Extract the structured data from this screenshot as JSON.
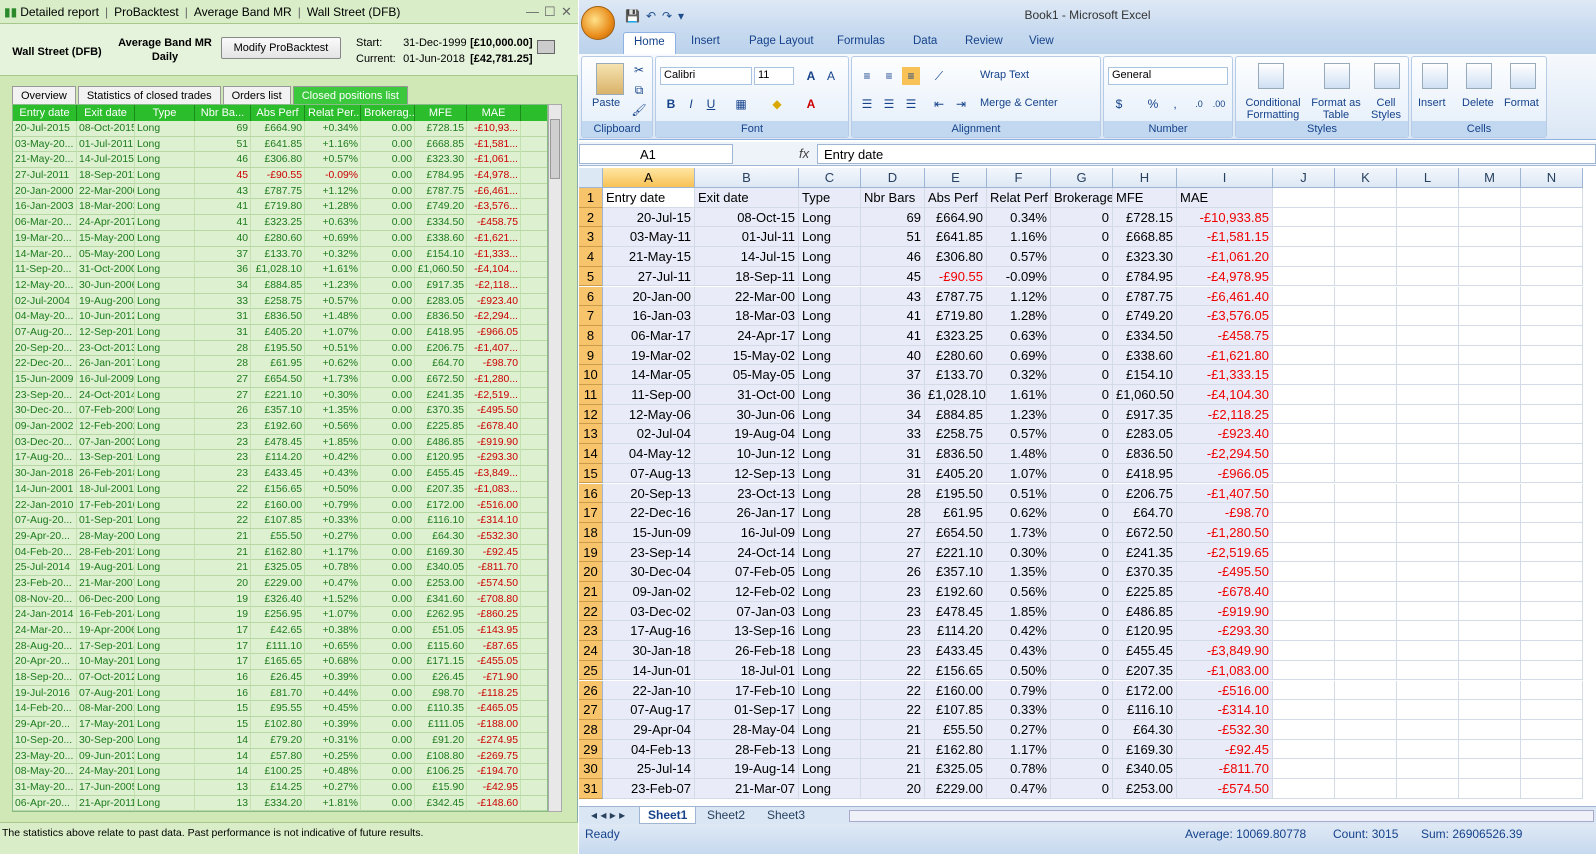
{
  "left": {
    "title": [
      "Detailed report",
      "ProBacktest",
      "Average Band MR",
      "Wall Street (DFB)"
    ],
    "symbol": "Wall Street (DFB)",
    "strategy": "Average Band MR",
    "period": "Daily",
    "modify_button": "Modify ProBacktest",
    "start_label": "Start:",
    "start_date": "31-Dec-1999",
    "start_value": "[£10,000.00]",
    "current_label": "Current:",
    "current_date": "01-Jun-2018",
    "current_value": "[£42,781.25]",
    "tabs": [
      "Overview",
      "Statistics of closed trades",
      "Orders list",
      "Closed positions list"
    ],
    "columns": [
      "Entry date",
      "Exit date",
      "Type",
      "Nbr Ba...",
      "Abs Perf",
      "Relat Per...",
      "Brokerag...",
      "MFE",
      "MAE"
    ],
    "footer": "The statistics above relate to past data. Past performance is not indicative of future results.",
    "rows": [
      [
        "20-Jul-2015",
        "08-Oct-2015",
        "Long",
        "69",
        "£664.90",
        "+0.34%",
        "0.00",
        "£728.15",
        "-£10,93..."
      ],
      [
        "03-May-20...",
        "01-Jul-2011",
        "Long",
        "51",
        "£641.85",
        "+1.16%",
        "0.00",
        "£668.85",
        "-£1,581..."
      ],
      [
        "21-May-20...",
        "14-Jul-2015",
        "Long",
        "46",
        "£306.80",
        "+0.57%",
        "0.00",
        "£323.30",
        "-£1,061..."
      ],
      [
        "27-Jul-2011",
        "18-Sep-2011",
        "Long",
        "45",
        "-£90.55",
        "-0.09%",
        "0.00",
        "£784.95",
        "-£4,978..."
      ],
      [
        "20-Jan-2000",
        "22-Mar-2000",
        "Long",
        "43",
        "£787.75",
        "+1.12%",
        "0.00",
        "£787.75",
        "-£6,461..."
      ],
      [
        "16-Jan-2003",
        "18-Mar-2003",
        "Long",
        "41",
        "£719.80",
        "+1.28%",
        "0.00",
        "£749.20",
        "-£3,576..."
      ],
      [
        "06-Mar-20...",
        "24-Apr-2017",
        "Long",
        "41",
        "£323.25",
        "+0.63%",
        "0.00",
        "£334.50",
        "-£458.75"
      ],
      [
        "19-Mar-20...",
        "15-May-2002",
        "Long",
        "40",
        "£280.60",
        "+0.69%",
        "0.00",
        "£338.60",
        "-£1,621..."
      ],
      [
        "14-Mar-20...",
        "05-May-2005",
        "Long",
        "37",
        "£133.70",
        "+0.32%",
        "0.00",
        "£154.10",
        "-£1,333..."
      ],
      [
        "11-Sep-20...",
        "31-Oct-2000",
        "Long",
        "36",
        "£1,028.10",
        "+1.61%",
        "0.00",
        "£1,060.50",
        "-£4,104..."
      ],
      [
        "12-May-20...",
        "30-Jun-2006",
        "Long",
        "34",
        "£884.85",
        "+1.23%",
        "0.00",
        "£917.35",
        "-£2,118..."
      ],
      [
        "02-Jul-2004",
        "19-Aug-2004",
        "Long",
        "33",
        "£258.75",
        "+0.57%",
        "0.00",
        "£283.05",
        "-£923.40"
      ],
      [
        "04-May-20...",
        "10-Jun-2012",
        "Long",
        "31",
        "£836.50",
        "+1.48%",
        "0.00",
        "£836.50",
        "-£2,294..."
      ],
      [
        "07-Aug-20...",
        "12-Sep-2013",
        "Long",
        "31",
        "£405.20",
        "+1.07%",
        "0.00",
        "£418.95",
        "-£966.05"
      ],
      [
        "20-Sep-20...",
        "23-Oct-2013",
        "Long",
        "28",
        "£195.50",
        "+0.51%",
        "0.00",
        "£206.75",
        "-£1,407..."
      ],
      [
        "22-Dec-20...",
        "26-Jan-2017",
        "Long",
        "28",
        "£61.95",
        "+0.62%",
        "0.00",
        "£64.70",
        "-£98.70"
      ],
      [
        "15-Jun-2009",
        "16-Jul-2009",
        "Long",
        "27",
        "£654.50",
        "+1.73%",
        "0.00",
        "£672.50",
        "-£1,280..."
      ],
      [
        "23-Sep-20...",
        "24-Oct-2014",
        "Long",
        "27",
        "£221.10",
        "+0.30%",
        "0.00",
        "£241.35",
        "-£2,519..."
      ],
      [
        "30-Dec-20...",
        "07-Feb-2005",
        "Long",
        "26",
        "£357.10",
        "+1.35%",
        "0.00",
        "£370.35",
        "-£495.50"
      ],
      [
        "09-Jan-2002",
        "12-Feb-2002",
        "Long",
        "23",
        "£192.60",
        "+0.56%",
        "0.00",
        "£225.85",
        "-£678.40"
      ],
      [
        "03-Dec-20...",
        "07-Jan-2003",
        "Long",
        "23",
        "£478.45",
        "+1.85%",
        "0.00",
        "£486.85",
        "-£919.90"
      ],
      [
        "17-Aug-20...",
        "13-Sep-2016",
        "Long",
        "23",
        "£114.20",
        "+0.42%",
        "0.00",
        "£120.95",
        "-£293.30"
      ],
      [
        "30-Jan-2018",
        "26-Feb-2018",
        "Long",
        "23",
        "£433.45",
        "+0.43%",
        "0.00",
        "£455.45",
        "-£3,849..."
      ],
      [
        "14-Jun-2001",
        "18-Jul-2001",
        "Long",
        "22",
        "£156.65",
        "+0.50%",
        "0.00",
        "£207.35",
        "-£1,083..."
      ],
      [
        "22-Jan-2010",
        "17-Feb-2010",
        "Long",
        "22",
        "£160.00",
        "+0.79%",
        "0.00",
        "£172.00",
        "-£516.00"
      ],
      [
        "07-Aug-20...",
        "01-Sep-2017",
        "Long",
        "22",
        "£107.85",
        "+0.33%",
        "0.00",
        "£116.10",
        "-£314.10"
      ],
      [
        "29-Apr-20...",
        "28-May-2004",
        "Long",
        "21",
        "£55.50",
        "+0.27%",
        "0.00",
        "£64.30",
        "-£532.30"
      ],
      [
        "04-Feb-20...",
        "28-Feb-2013",
        "Long",
        "21",
        "£162.80",
        "+1.17%",
        "0.00",
        "£169.30",
        "-£92.45"
      ],
      [
        "25-Jul-2014",
        "19-Aug-2014",
        "Long",
        "21",
        "£325.05",
        "+0.78%",
        "0.00",
        "£340.05",
        "-£811.70"
      ],
      [
        "23-Feb-20...",
        "21-Mar-2007",
        "Long",
        "20",
        "£229.00",
        "+0.47%",
        "0.00",
        "£253.00",
        "-£574.50"
      ],
      [
        "08-Nov-20...",
        "06-Dec-2000",
        "Long",
        "19",
        "£326.40",
        "+1.52%",
        "0.00",
        "£341.60",
        "-£708.80"
      ],
      [
        "24-Jan-2014",
        "16-Feb-2014",
        "Long",
        "19",
        "£256.95",
        "+1.07%",
        "0.00",
        "£262.95",
        "-£860.25"
      ],
      [
        "24-Mar-20...",
        "19-Apr-2006",
        "Long",
        "17",
        "£42.65",
        "+0.38%",
        "0.00",
        "£51.05",
        "-£143.95"
      ],
      [
        "28-Aug-20...",
        "17-Sep-2014",
        "Long",
        "17",
        "£111.10",
        "+0.65%",
        "0.00",
        "£115.60",
        "-£87.65"
      ],
      [
        "20-Apr-20...",
        "10-May-2018",
        "Long",
        "17",
        "£165.65",
        "+0.68%",
        "0.00",
        "£171.15",
        "-£455.05"
      ],
      [
        "18-Sep-20...",
        "07-Oct-2012",
        "Long",
        "16",
        "£26.45",
        "+0.39%",
        "0.00",
        "£26.45",
        "-£71.90"
      ],
      [
        "19-Jul-2016",
        "07-Aug-2016",
        "Long",
        "16",
        "£81.70",
        "+0.44%",
        "0.00",
        "£98.70",
        "-£118.25"
      ],
      [
        "14-Feb-20...",
        "08-Mar-2001",
        "Long",
        "15",
        "£95.55",
        "+0.45%",
        "0.00",
        "£110.35",
        "-£465.05"
      ],
      [
        "29-Apr-20...",
        "17-May-2016",
        "Long",
        "15",
        "£102.80",
        "+0.39%",
        "0.00",
        "£111.05",
        "-£188.00"
      ],
      [
        "10-Sep-20...",
        "30-Sep-2004",
        "Long",
        "14",
        "£79.20",
        "+0.31%",
        "0.00",
        "£91.20",
        "-£274.95"
      ],
      [
        "23-May-20...",
        "09-Jun-2013",
        "Long",
        "14",
        "£57.80",
        "+0.25%",
        "0.00",
        "£108.80",
        "-£269.75"
      ],
      [
        "08-May-20...",
        "24-May-2017",
        "Long",
        "14",
        "£100.25",
        "+0.48%",
        "0.00",
        "£106.25",
        "-£194.70"
      ],
      [
        "31-May-20...",
        "17-Jun-2005",
        "Long",
        "13",
        "£14.25",
        "+0.27%",
        "0.00",
        "£15.90",
        "-£42.95"
      ],
      [
        "06-Apr-20...",
        "21-Apr-2011",
        "Long",
        "13",
        "£334.20",
        "+1.81%",
        "0.00",
        "£342.45",
        "-£148.60"
      ]
    ]
  },
  "excel": {
    "title": "Book1 - Microsoft Excel",
    "ribbon_tabs": [
      "Home",
      "Insert",
      "Page Layout",
      "Formulas",
      "Data",
      "Review",
      "View"
    ],
    "groups": {
      "clipboard": "Clipboard",
      "font": "Font",
      "alignment": "Alignment",
      "number": "Number",
      "styles": "Styles",
      "cells": "Cells"
    },
    "paste": "Paste",
    "font_name": "Calibri",
    "font_size": "11",
    "wrap_text": "Wrap Text",
    "merge_center": "Merge & Center",
    "number_format": "General",
    "cond_format": "Conditional Formatting",
    "format_table": "Format as Table",
    "cell_styles": "Cell Styles",
    "insert": "Insert",
    "delete": "Delete",
    "format": "Format",
    "name_box": "A1",
    "fx": "fx",
    "formula": "Entry date",
    "col_letters": [
      "A",
      "B",
      "C",
      "D",
      "E",
      "F",
      "G",
      "H",
      "I",
      "J",
      "K",
      "L",
      "M",
      "N"
    ],
    "header_row": [
      "Entry date",
      "Exit date",
      "Type",
      "Nbr Bars",
      "Abs Perf",
      "Relat Perf",
      "Brokerage",
      "MFE",
      "MAE"
    ],
    "rows": [
      [
        "20-Jul-15",
        "08-Oct-15",
        "Long",
        "69",
        "£664.90",
        "0.34%",
        "0",
        "£728.15",
        "-£10,933.85"
      ],
      [
        "03-May-11",
        "01-Jul-11",
        "Long",
        "51",
        "£641.85",
        "1.16%",
        "0",
        "£668.85",
        "-£1,581.15"
      ],
      [
        "21-May-15",
        "14-Jul-15",
        "Long",
        "46",
        "£306.80",
        "0.57%",
        "0",
        "£323.30",
        "-£1,061.20"
      ],
      [
        "27-Jul-11",
        "18-Sep-11",
        "Long",
        "45",
        "-£90.55",
        "-0.09%",
        "0",
        "£784.95",
        "-£4,978.95"
      ],
      [
        "20-Jan-00",
        "22-Mar-00",
        "Long",
        "43",
        "£787.75",
        "1.12%",
        "0",
        "£787.75",
        "-£6,461.40"
      ],
      [
        "16-Jan-03",
        "18-Mar-03",
        "Long",
        "41",
        "£719.80",
        "1.28%",
        "0",
        "£749.20",
        "-£3,576.05"
      ],
      [
        "06-Mar-17",
        "24-Apr-17",
        "Long",
        "41",
        "£323.25",
        "0.63%",
        "0",
        "£334.50",
        "-£458.75"
      ],
      [
        "19-Mar-02",
        "15-May-02",
        "Long",
        "40",
        "£280.60",
        "0.69%",
        "0",
        "£338.60",
        "-£1,621.80"
      ],
      [
        "14-Mar-05",
        "05-May-05",
        "Long",
        "37",
        "£133.70",
        "0.32%",
        "0",
        "£154.10",
        "-£1,333.15"
      ],
      [
        "11-Sep-00",
        "31-Oct-00",
        "Long",
        "36",
        "£1,028.10",
        "1.61%",
        "0",
        "£1,060.50",
        "-£4,104.30"
      ],
      [
        "12-May-06",
        "30-Jun-06",
        "Long",
        "34",
        "£884.85",
        "1.23%",
        "0",
        "£917.35",
        "-£2,118.25"
      ],
      [
        "02-Jul-04",
        "19-Aug-04",
        "Long",
        "33",
        "£258.75",
        "0.57%",
        "0",
        "£283.05",
        "-£923.40"
      ],
      [
        "04-May-12",
        "10-Jun-12",
        "Long",
        "31",
        "£836.50",
        "1.48%",
        "0",
        "£836.50",
        "-£2,294.50"
      ],
      [
        "07-Aug-13",
        "12-Sep-13",
        "Long",
        "31",
        "£405.20",
        "1.07%",
        "0",
        "£418.95",
        "-£966.05"
      ],
      [
        "20-Sep-13",
        "23-Oct-13",
        "Long",
        "28",
        "£195.50",
        "0.51%",
        "0",
        "£206.75",
        "-£1,407.50"
      ],
      [
        "22-Dec-16",
        "26-Jan-17",
        "Long",
        "28",
        "£61.95",
        "0.62%",
        "0",
        "£64.70",
        "-£98.70"
      ],
      [
        "15-Jun-09",
        "16-Jul-09",
        "Long",
        "27",
        "£654.50",
        "1.73%",
        "0",
        "£672.50",
        "-£1,280.50"
      ],
      [
        "23-Sep-14",
        "24-Oct-14",
        "Long",
        "27",
        "£221.10",
        "0.30%",
        "0",
        "£241.35",
        "-£2,519.65"
      ],
      [
        "30-Dec-04",
        "07-Feb-05",
        "Long",
        "26",
        "£357.10",
        "1.35%",
        "0",
        "£370.35",
        "-£495.50"
      ],
      [
        "09-Jan-02",
        "12-Feb-02",
        "Long",
        "23",
        "£192.60",
        "0.56%",
        "0",
        "£225.85",
        "-£678.40"
      ],
      [
        "03-Dec-02",
        "07-Jan-03",
        "Long",
        "23",
        "£478.45",
        "1.85%",
        "0",
        "£486.85",
        "-£919.90"
      ],
      [
        "17-Aug-16",
        "13-Sep-16",
        "Long",
        "23",
        "£114.20",
        "0.42%",
        "0",
        "£120.95",
        "-£293.30"
      ],
      [
        "30-Jan-18",
        "26-Feb-18",
        "Long",
        "23",
        "£433.45",
        "0.43%",
        "0",
        "£455.45",
        "-£3,849.90"
      ],
      [
        "14-Jun-01",
        "18-Jul-01",
        "Long",
        "22",
        "£156.65",
        "0.50%",
        "0",
        "£207.35",
        "-£1,083.00"
      ],
      [
        "22-Jan-10",
        "17-Feb-10",
        "Long",
        "22",
        "£160.00",
        "0.79%",
        "0",
        "£172.00",
        "-£516.00"
      ],
      [
        "07-Aug-17",
        "01-Sep-17",
        "Long",
        "22",
        "£107.85",
        "0.33%",
        "0",
        "£116.10",
        "-£314.10"
      ],
      [
        "29-Apr-04",
        "28-May-04",
        "Long",
        "21",
        "£55.50",
        "0.27%",
        "0",
        "£64.30",
        "-£532.30"
      ],
      [
        "04-Feb-13",
        "28-Feb-13",
        "Long",
        "21",
        "£162.80",
        "1.17%",
        "0",
        "£169.30",
        "-£92.45"
      ],
      [
        "25-Jul-14",
        "19-Aug-14",
        "Long",
        "21",
        "£325.05",
        "0.78%",
        "0",
        "£340.05",
        "-£811.70"
      ],
      [
        "23-Feb-07",
        "21-Mar-07",
        "Long",
        "20",
        "£229.00",
        "0.47%",
        "0",
        "£253.00",
        "-£574.50"
      ]
    ],
    "sheet_tabs": [
      "Sheet1",
      "Sheet2",
      "Sheet3"
    ],
    "status": {
      "ready": "Ready",
      "average": "Average: 10069.80778",
      "count": "Count: 3015",
      "sum": "Sum: 26906526.39"
    }
  }
}
